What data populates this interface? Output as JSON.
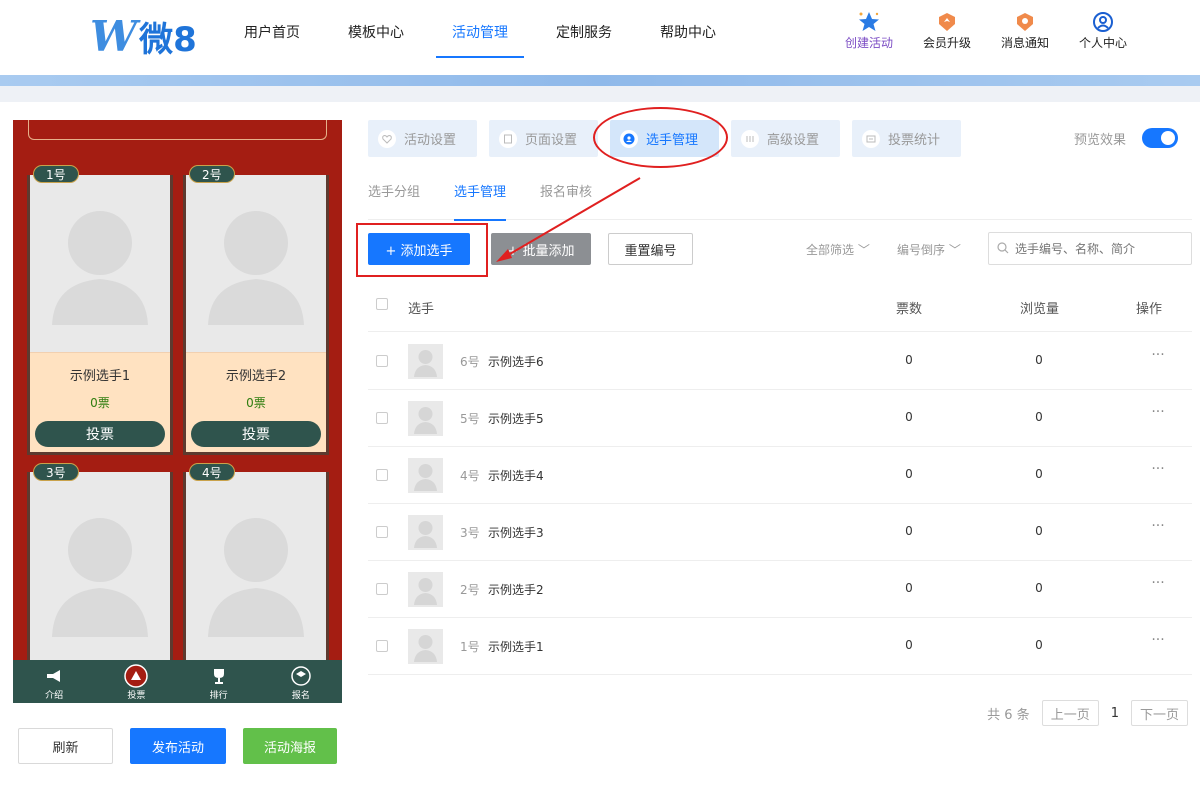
{
  "header": {
    "logo_w": "W",
    "logo_text": "微8",
    "nav": [
      "用户首页",
      "模板中心",
      "活动管理",
      "定制服务",
      "帮助中心"
    ],
    "tools": [
      {
        "label": "创建活动",
        "icon": "star-icon"
      },
      {
        "label": "会员升级",
        "icon": "member-upgrade-icon"
      },
      {
        "label": "消息通知",
        "icon": "notification-icon"
      },
      {
        "label": "个人中心",
        "icon": "user-icon"
      }
    ]
  },
  "preview": {
    "contestants": [
      {
        "badge": "1号",
        "name": "示例选手1",
        "votes": "0票",
        "vote_label": "投票"
      },
      {
        "badge": "2号",
        "name": "示例选手2",
        "votes": "0票",
        "vote_label": "投票"
      },
      {
        "badge": "3号"
      },
      {
        "badge": "4号"
      }
    ],
    "bottom_nav": [
      "介绍",
      "投票",
      "排行",
      "报名"
    ],
    "actions": {
      "refresh": "刷新",
      "publish": "发布活动",
      "poster": "活动海报"
    }
  },
  "steps": [
    "活动设置",
    "页面设置",
    "选手管理",
    "高级设置",
    "投票统计"
  ],
  "preview_toggle": {
    "label": "预览效果",
    "on": true
  },
  "subtabs": [
    "选手分组",
    "选手管理",
    "报名审核"
  ],
  "toolbar": {
    "add": "+ 添加选手",
    "batch_add": "+ 批量添加",
    "renumber": "重置编号",
    "filter_all": "全部筛选",
    "sort": "编号倒序",
    "search_placeholder": "选手编号、名称、简介"
  },
  "table": {
    "headers": {
      "player": "选手",
      "votes": "票数",
      "views": "浏览量",
      "ops": "操作"
    },
    "rows": [
      {
        "num": "6号",
        "name": "示例选手6",
        "votes": "0",
        "views": "0",
        "ops": "···"
      },
      {
        "num": "5号",
        "name": "示例选手5",
        "votes": "0",
        "views": "0",
        "ops": "···"
      },
      {
        "num": "4号",
        "name": "示例选手4",
        "votes": "0",
        "views": "0",
        "ops": "···"
      },
      {
        "num": "3号",
        "name": "示例选手3",
        "votes": "0",
        "views": "0",
        "ops": "···"
      },
      {
        "num": "2号",
        "name": "示例选手2",
        "votes": "0",
        "views": "0",
        "ops": "···"
      },
      {
        "num": "1号",
        "name": "示例选手1",
        "votes": "0",
        "views": "0",
        "ops": "···"
      }
    ]
  },
  "pagination": {
    "total": "共 6 条",
    "prev": "上一页",
    "page": "1",
    "next": "下一页"
  },
  "colors": {
    "primary": "#1677ff",
    "green": "#62c04a",
    "preview_bg": "#a41d12",
    "annotation": "#e02020"
  }
}
